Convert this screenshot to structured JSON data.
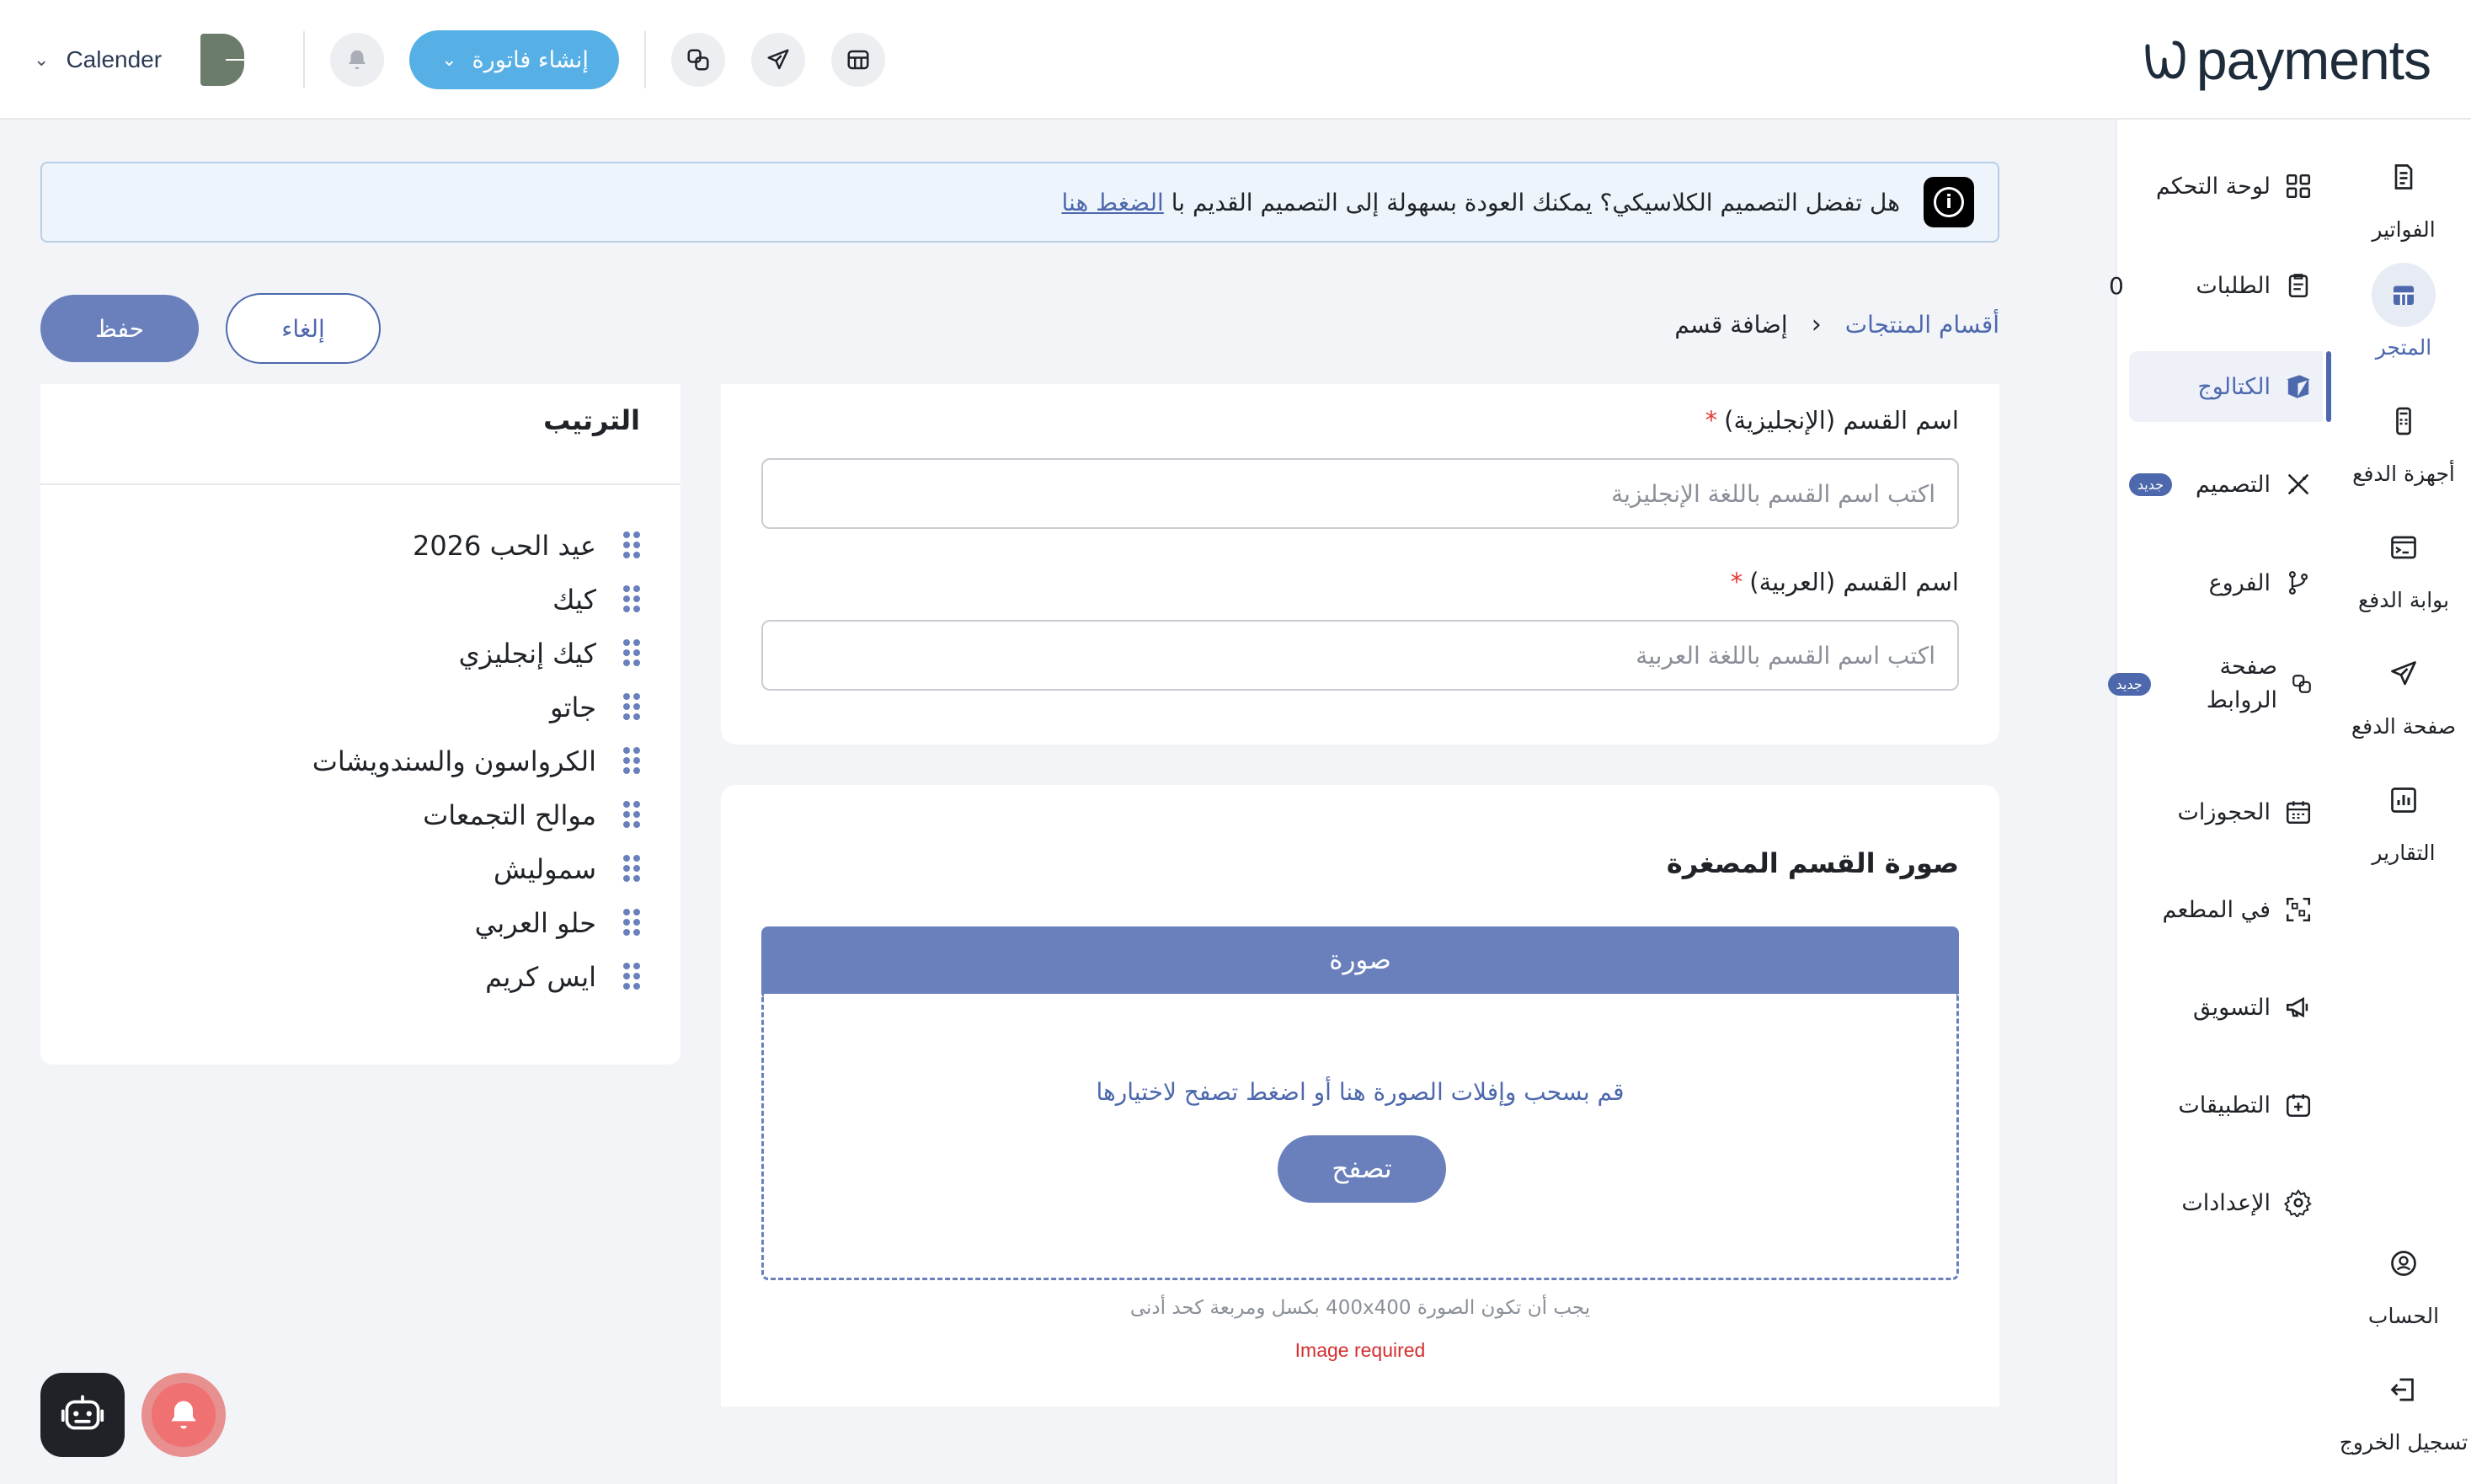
{
  "header": {
    "brand_name": "payments",
    "calendar_label": "Calender",
    "create_invoice_label": "إنشاء فاتورة"
  },
  "rail": {
    "items": [
      {
        "label": "الفواتير",
        "icon": "invoice-icon"
      },
      {
        "label": "المتجر",
        "icon": "store-icon",
        "active": true
      },
      {
        "label": "أجهزة الدفع",
        "icon": "pos-device-icon"
      },
      {
        "label": "بوابة الدفع",
        "icon": "gateway-icon"
      },
      {
        "label": "صفحة الدفع",
        "icon": "send-icon"
      },
      {
        "label": "التقارير",
        "icon": "reports-icon"
      },
      {
        "label": "الحساب",
        "icon": "account-icon"
      },
      {
        "label": "تسجيل الخروج",
        "icon": "logout-icon"
      }
    ]
  },
  "submenu": {
    "items": [
      {
        "label": "لوحة التحكم",
        "icon": "dashboard-icon"
      },
      {
        "label": "الطلبات",
        "icon": "orders-icon",
        "count": "0"
      },
      {
        "label": "الكتالوج",
        "icon": "catalog-icon",
        "active": true
      },
      {
        "label": "التصميم",
        "icon": "design-icon",
        "badge": "جديد"
      },
      {
        "label": "الفروع",
        "icon": "branches-icon"
      },
      {
        "label_line1": "صفحة",
        "label_line2": "الروابط",
        "icon": "links-icon",
        "badge": "جديد"
      },
      {
        "label": "الحجوزات",
        "icon": "calendar-icon"
      },
      {
        "label": "في المطعم",
        "icon": "qr-icon"
      },
      {
        "label": "التسويق",
        "icon": "megaphone-icon"
      },
      {
        "label": "التطبيقات",
        "icon": "apps-icon"
      },
      {
        "label": "الإعدادات",
        "icon": "settings-icon"
      }
    ]
  },
  "banner": {
    "text": "هل تفضل التصميم الكلاسيكي؟ يمكنك العودة بسهولة إلى التصميم القديم با",
    "link": "الضغط هنا"
  },
  "breadcrumb": {
    "parent": "أقسام المنتجات",
    "current": "إضافة قسم"
  },
  "actions": {
    "cancel": "إلغاء",
    "save": "حفظ"
  },
  "order": {
    "title": "الترتيب",
    "items": [
      "عيد الحب 2026",
      "كيك",
      "كيك إنجليزي",
      "جاتو",
      "الكرواسون والسندويشات",
      "موالح التجمعات",
      "سموليش",
      "حلو العربي",
      "ايس كريم"
    ]
  },
  "form": {
    "name_en_label": "اسم القسم (الإنجليزية)",
    "name_en_placeholder": "اكتب اسم القسم باللغة الإنجليزية",
    "name_ar_label": "اسم القسم (العربية)",
    "name_ar_placeholder": "اكتب اسم القسم باللغة العربية",
    "required_mark": "*"
  },
  "image": {
    "title": "صورة القسم المصغرة",
    "header": "صورة",
    "drop_text": "قم بسحب وإفلات الصورة هنا أو اضغط تصفح لاختيارها",
    "browse": "تصفح",
    "hint": "يجب أن تكون الصورة 400x400 بكسل ومربعة كحد أدنى",
    "error": "Image required"
  },
  "colors": {
    "primary": "#4d68ad",
    "primary_fill": "#6a80bd",
    "create_button": "#56b0e6",
    "error": "#d32f2f"
  }
}
